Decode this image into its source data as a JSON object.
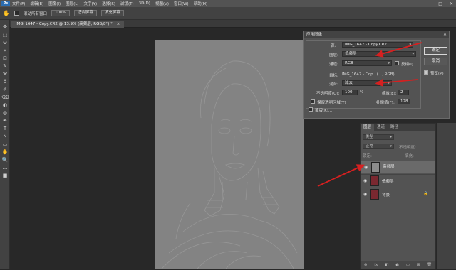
{
  "menubar": {
    "logo": "Ps",
    "items": [
      "文件(F)",
      "编辑(E)",
      "图像(I)",
      "图层(L)",
      "文字(Y)",
      "选择(S)",
      "滤镜(T)",
      "3D(D)",
      "视图(V)",
      "窗口(W)",
      "帮助(H)"
    ],
    "window_controls": [
      "—",
      "□",
      "✕"
    ]
  },
  "options_bar": {
    "tool_icon": "hand-icon",
    "scroll_all_label": "滚动所有窗口",
    "zoom": "100%",
    "fit_screen": "适合屏幕",
    "fill_screen": "填充屏幕"
  },
  "document_tab": {
    "title": "IMG_1647 - Copy.CR2 @ 13.9% (高频层, RGB/8*) *",
    "close": "×"
  },
  "tools": [
    "✥",
    "⬚",
    "ʘ",
    "⌖",
    "⊡",
    "✎",
    "⚒",
    "♁",
    "✐",
    "⌫",
    "◐",
    "◍",
    "✒",
    "T",
    "↖",
    "▭",
    "✋",
    "🔍",
    "…",
    "■"
  ],
  "dialog": {
    "title": "应用图像",
    "close": "✕",
    "source_label": "源:",
    "source_value": "IMG_1647 - Copy.CR2",
    "layer_label": "图层:",
    "layer_value": "低频层",
    "channel_label": "通道:",
    "channel_value": "RGB",
    "invert_label": "反相(I)",
    "target_label": "目标:",
    "target_value": "IMG_1647 - Cop...(..., RGB)",
    "blending_label": "混合:",
    "blending_value": "减去",
    "opacity_label": "不透明度(O):",
    "opacity_value": "100",
    "opacity_unit": "%",
    "scale_label": "缩放(E):",
    "scale_value": "2",
    "offset_label": "补偿值(F):",
    "offset_value": "128",
    "preserve_label": "保留透明区域(T)",
    "mask_label": "蒙版(K)...",
    "ok_label": "确定",
    "cancel_label": "取消",
    "preview_label": "预览(P)",
    "preview_checked": true
  },
  "layers_panel": {
    "tabs": [
      "图层",
      "通道",
      "路径"
    ],
    "kind_label": "类型",
    "blend_mode": "正常",
    "opacity_label": "不透明度:",
    "lock_label": "锁定:",
    "fill_label": "填充:",
    "rows": [
      {
        "name": "高频层",
        "selected": true,
        "thumb": "#8c8c8c"
      },
      {
        "name": "低频层",
        "selected": false,
        "thumb": "#7a2830"
      },
      {
        "name": "背景",
        "selected": false,
        "thumb": "#7a2830",
        "locked": "🔒"
      }
    ],
    "footer_icons": [
      "⊕",
      "fx",
      "◧",
      "◐",
      "▭",
      "⊞",
      "🗑"
    ]
  },
  "colors": {
    "accent_arrow": "#d62020",
    "bg": "#282828",
    "panel": "#535353"
  }
}
